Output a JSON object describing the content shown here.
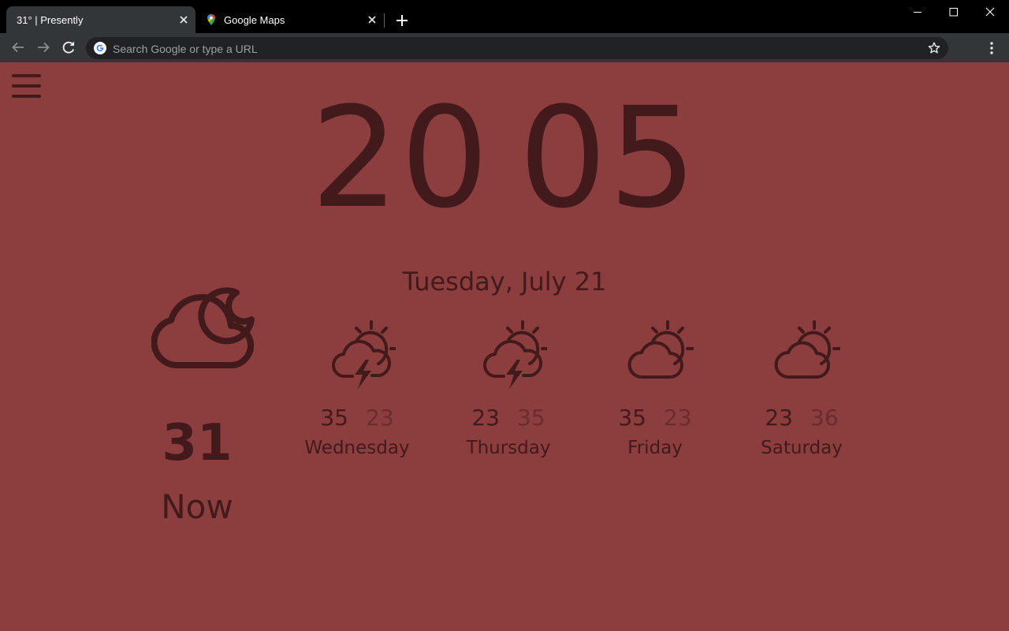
{
  "browser": {
    "tabs": [
      {
        "title": "31° | Presently",
        "active": true
      },
      {
        "title": "Google Maps",
        "active": false,
        "favicon": "maps-pin-icon"
      }
    ],
    "omnibox_placeholder": "Search Google or type a URL"
  },
  "colors": {
    "page_background": "#8c3d3e",
    "foreground": "#421a1b",
    "low_temp": "#6a2d2e"
  },
  "clock": {
    "hours": "20",
    "minutes": "05"
  },
  "date": "Tuesday, July 21",
  "current": {
    "temp": "31",
    "label": "Now",
    "icon": "cloudy-night-icon"
  },
  "forecast": [
    {
      "day": "Wednesday",
      "high": "35",
      "low": "23",
      "icon": "thunderstorm-sun-icon"
    },
    {
      "day": "Thursday",
      "high": "23",
      "low": "35",
      "icon": "thunderstorm-sun-icon"
    },
    {
      "day": "Friday",
      "high": "35",
      "low": "23",
      "icon": "partly-cloudy-day-icon"
    },
    {
      "day": "Saturday",
      "high": "23",
      "low": "36",
      "icon": "partly-cloudy-day-icon"
    }
  ]
}
